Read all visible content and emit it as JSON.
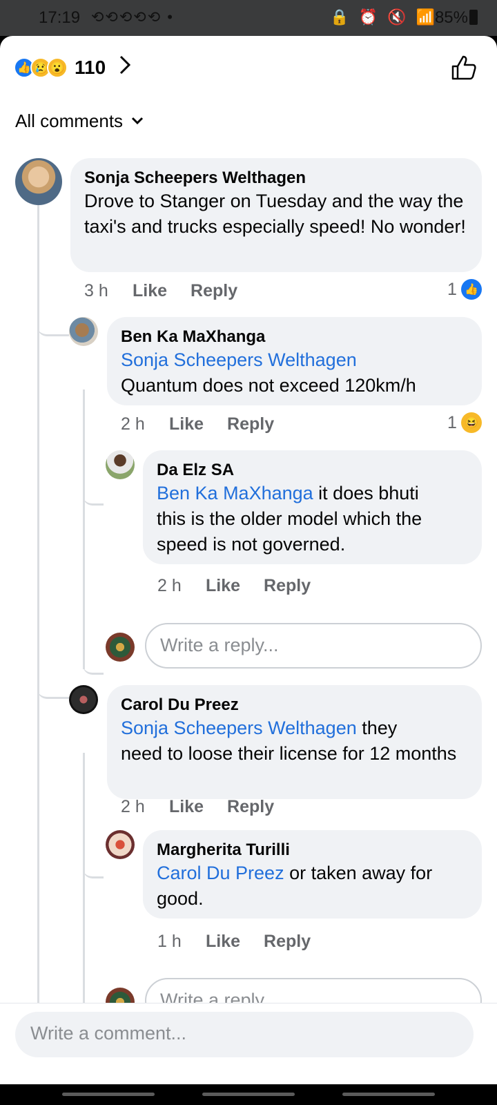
{
  "status_bar": {
    "time": "17:19",
    "notifications": "⟲⟲⟲⟲⟲ •",
    "sys_icons": "🔒 ⏰ 🔇 📶",
    "battery": "85%"
  },
  "header": {
    "reaction_count": "110"
  },
  "filter": {
    "label": "All comments"
  },
  "comments": [
    {
      "author": "Sonja Scheepers Welthagen",
      "text": "Drove to Stanger on Tuesday and the way the taxi's and trucks especially speed!  No wonder!",
      "time": "3 h",
      "like": "Like",
      "reply": "Reply",
      "reaction_count": "1"
    },
    {
      "author": "Ben Ka MaXhanga",
      "mention": "Sonja Scheepers Welthagen",
      "text": "Quantum does not exceed 120km/h",
      "time": "2 h",
      "like": "Like",
      "reply": "Reply",
      "reaction_count": "1"
    },
    {
      "author": "Da Elz SA",
      "mention": "Ben Ka MaXhanga",
      "text_inline": " it does bhuti",
      "text": "this is the older model which the speed is not governed.",
      "time": "2 h",
      "like": "Like",
      "reply": "Reply"
    },
    {
      "author": "Carol Du Preez",
      "mention": "Sonja Scheepers Welthagen",
      "text_inline": " they",
      "text": "need to loose their license for 12 months",
      "time": "2 h",
      "like": "Like",
      "reply": "Reply"
    },
    {
      "author": "Margherita Turilli",
      "mention": "Carol Du Preez",
      "text_inline": " or taken away for",
      "text": "good.",
      "time": "1 h",
      "like": "Like",
      "reply": "Reply"
    }
  ],
  "reply_placeholder": "Write a reply...",
  "comment_placeholder": "Write a comment...",
  "colors": {
    "mention": "#216fdb",
    "like_blue": "#1877f2",
    "bubble": "#f0f2f5"
  }
}
